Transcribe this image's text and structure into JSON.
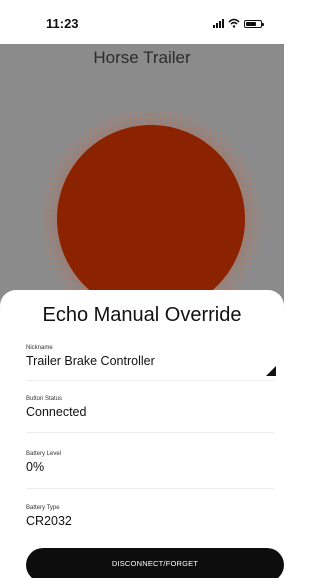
{
  "status_bar": {
    "time": "11:23",
    "signal_icon": "cellular-signal-icon",
    "wifi_icon": "wifi-icon",
    "battery_icon": "battery-icon"
  },
  "hero": {
    "title": "Horse Trailer",
    "status_circle_color": "#8b2200",
    "status_halo_color": "#b4583f"
  },
  "sheet": {
    "title": "Echo Manual Override",
    "fields": [
      {
        "label": "Nickname",
        "value": "Trailer Brake Controller",
        "editable": true
      },
      {
        "label": "Button Status",
        "value": "Connected"
      },
      {
        "label": "Battery Level",
        "value": "0%"
      },
      {
        "label": "Battery Type",
        "value": "CR2032"
      }
    ],
    "disconnect_label": "DISCONNECT/FORGET"
  },
  "colors": {
    "sheet_background": "#ffffff",
    "hero_background": "#8b8b8b",
    "button_background": "#0d0d0d"
  }
}
